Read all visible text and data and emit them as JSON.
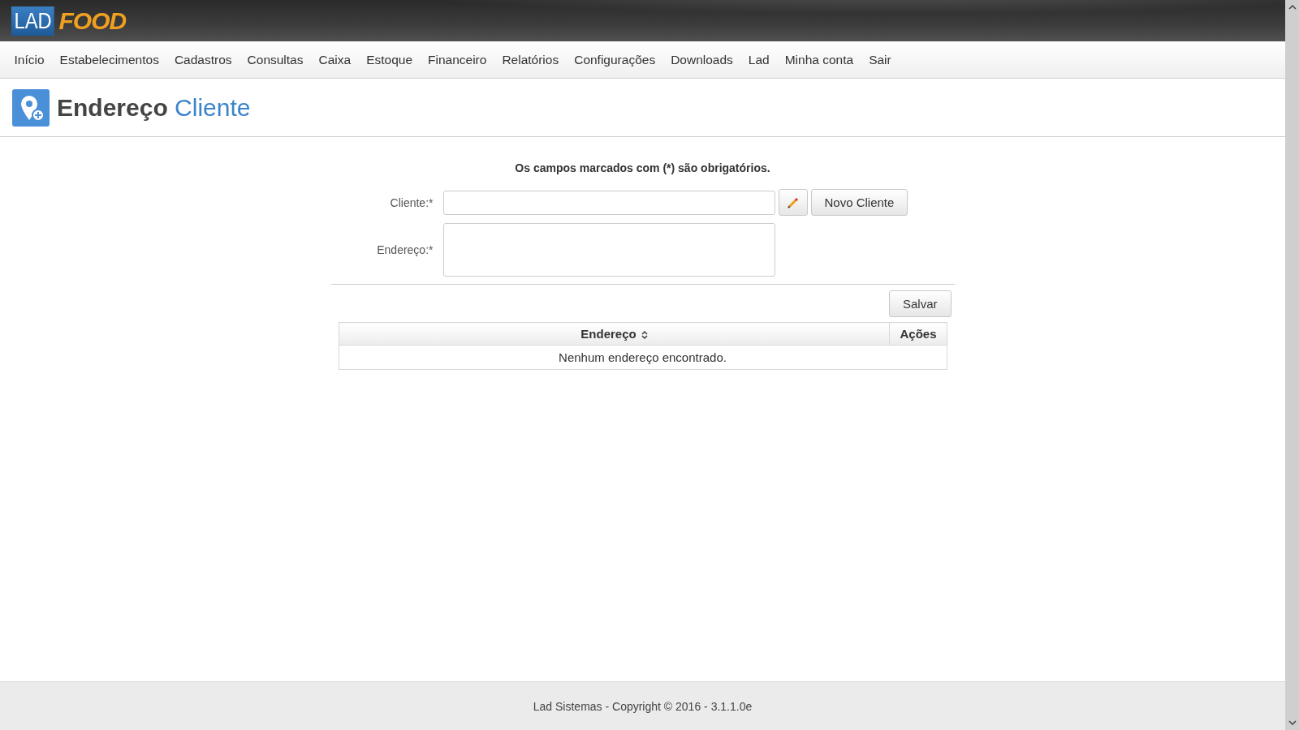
{
  "logo": {
    "part_1": "LAD",
    "part_2": "FOOD"
  },
  "menu": [
    {
      "label": "Início"
    },
    {
      "label": "Estabelecimentos"
    },
    {
      "label": "Cadastros"
    },
    {
      "label": "Consultas"
    },
    {
      "label": "Caixa"
    },
    {
      "label": "Estoque"
    },
    {
      "label": "Financeiro"
    },
    {
      "label": "Relatórios"
    },
    {
      "label": "Configurações"
    },
    {
      "label": "Downloads"
    },
    {
      "label": "Lad"
    },
    {
      "label": "Minha conta"
    },
    {
      "label": "Sair"
    }
  ],
  "page_title": {
    "part_1": "Endereço",
    "part_2": "Cliente"
  },
  "form": {
    "note": "Os campos marcados com (*) são obrigatórios.",
    "fields": [
      {
        "label": "Cliente:*",
        "kind": "input"
      },
      {
        "label": "Endereço:*",
        "kind": "textarea"
      }
    ],
    "new_client_button": "Novo Cliente",
    "save_button": "Salvar"
  },
  "table": {
    "columns": [
      {
        "label": "Endereço",
        "sortable": true
      },
      {
        "label": "Ações",
        "sortable": false
      }
    ],
    "empty_message": "Nenhum endereço encontrado."
  },
  "footer": "Lad Sistemas - Copyright © 2016 - 3.1.1.0e"
}
